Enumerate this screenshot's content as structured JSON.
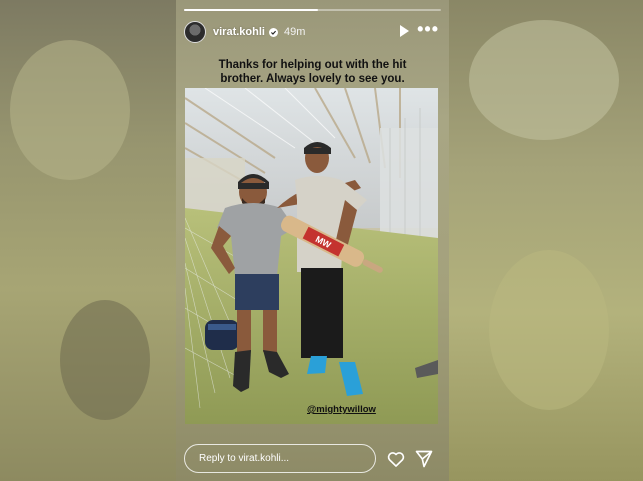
{
  "story": {
    "username": "virat.kohli",
    "time": "49m",
    "progress": 0.52,
    "caption_line1": "Thanks for helping out with the hit",
    "caption_line2": "brother. Always lovely to see you.",
    "mention": "@mightywillow",
    "bat_text": "MW"
  },
  "footer": {
    "reply_placeholder": "Reply to virat.kohli..."
  },
  "icons": {
    "verified": "verified-badge-icon",
    "play": "play-icon",
    "more": "more-options-icon",
    "like": "heart-icon",
    "share": "send-icon"
  },
  "colors": {
    "text_dark": "#111111",
    "ui_white": "#ffffff"
  }
}
